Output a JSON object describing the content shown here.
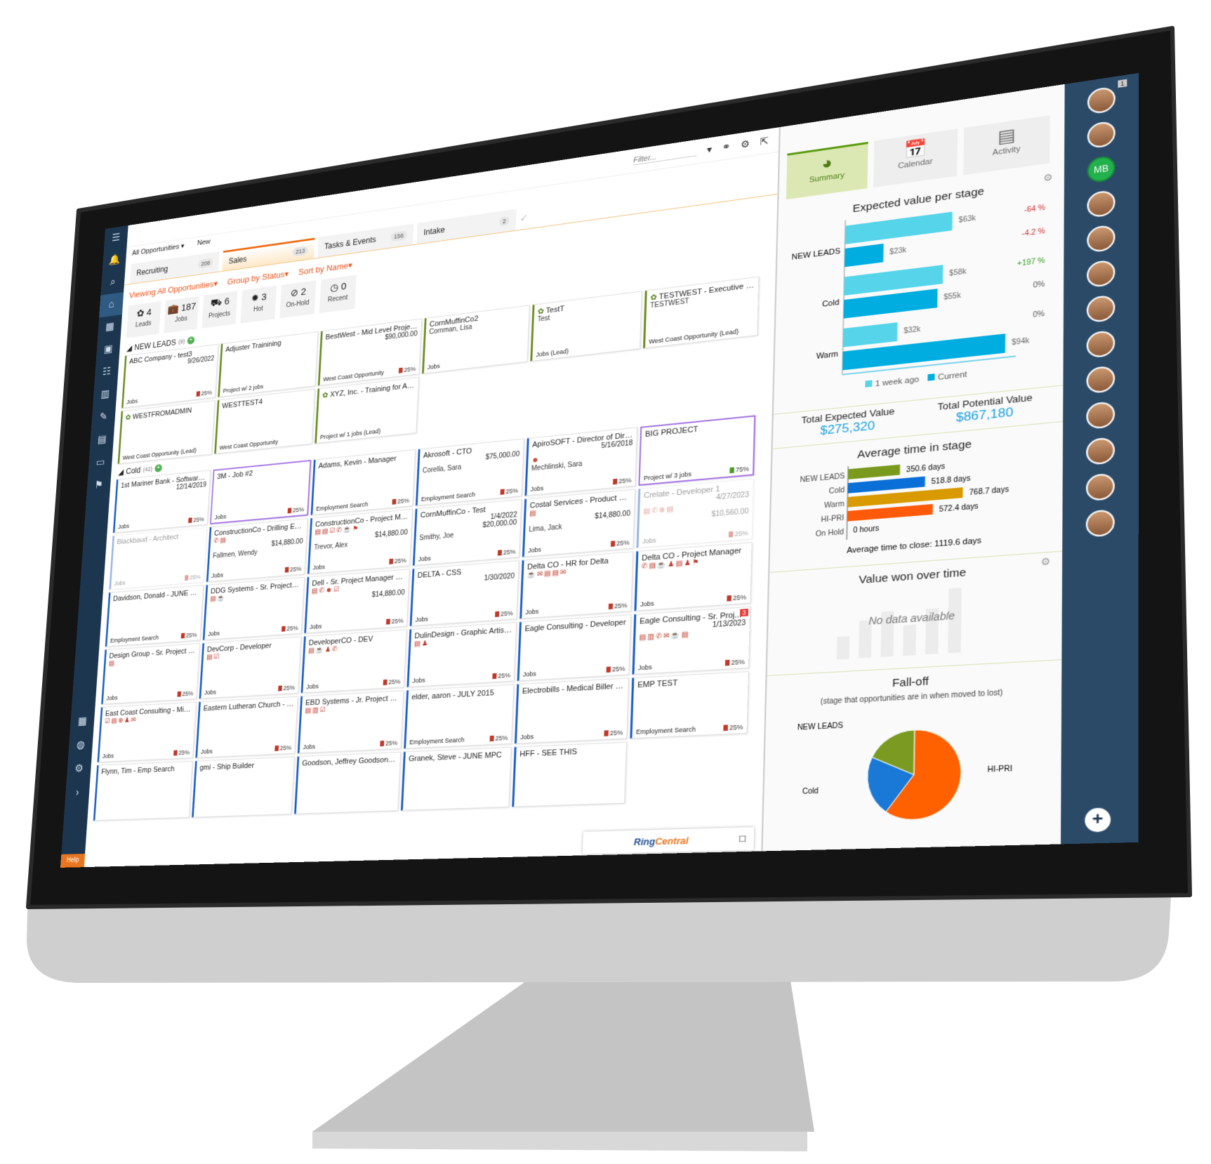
{
  "nav": {
    "icons": [
      "menu-icon",
      "bell-icon",
      "search-icon",
      "home-icon",
      "building-icon",
      "briefcase-icon",
      "people-icon",
      "chart-icon",
      "megaphone-icon",
      "document-icon",
      "folder-icon",
      "flag-icon",
      "calendar-icon",
      "globe-icon",
      "settings-icon",
      "chevron-right-icon"
    ],
    "help": "Help"
  },
  "topbar": {
    "filter_placeholder": "Filter..."
  },
  "viewtabs": {
    "all": "All Opportunities ▾",
    "new": "New"
  },
  "tabs": [
    {
      "label": "Recruiting",
      "count": "208"
    },
    {
      "label": "Sales",
      "count": "213",
      "active": true
    },
    {
      "label": "Tasks & Events",
      "count": "156"
    },
    {
      "label": "Intake",
      "count": "2"
    }
  ],
  "viewrow": {
    "viewing": "Viewing",
    "viewing_val": "All Opportunities▾",
    "group": "Group by",
    "group_val": "Status▾",
    "sort": "Sort by",
    "sort_val": "Name▾"
  },
  "stats": [
    {
      "icon": "sprout-icon",
      "glyph": "✿",
      "value": "4",
      "label": "Leads"
    },
    {
      "icon": "briefcase-icon",
      "glyph": "💼",
      "value": "187",
      "label": "Jobs"
    },
    {
      "icon": "project-icon",
      "glyph": "⛟",
      "value": "6",
      "label": "Projects"
    },
    {
      "icon": "hot-icon",
      "glyph": "✹",
      "value": "3",
      "label": "Hot"
    },
    {
      "icon": "on-hold-icon",
      "glyph": "⊘",
      "value": "2",
      "label": "On-Hold"
    },
    {
      "icon": "clock-icon",
      "glyph": "◷",
      "value": "0",
      "label": "Recent"
    }
  ],
  "groups": [
    {
      "name": "NEW LEADS",
      "count": "(9)",
      "kind": "lead",
      "cards": [
        {
          "title": "ABC Company - test3",
          "date": "9/26/2022",
          "type": "Jobs",
          "pct": "25%"
        },
        {
          "title": "Adjuster Trainining",
          "type": "Project w/ 2 jobs"
        },
        {
          "title": "BestWest - Mid Level Project ...",
          "value": "$90,000.00",
          "type": "West Coast Opportunity",
          "pct": "25%"
        },
        {
          "title": "CornMuffinCo2",
          "contact": "Cornman, Lisa",
          "type": "Jobs"
        },
        {
          "title": "TestT",
          "lead": true,
          "contact": "Test",
          "type": "Jobs (Lead)"
        },
        {
          "title": "TESTWEST - Executive Dir...",
          "lead": true,
          "contact": "TESTWEST",
          "type": "West Coast Opportunity (Lead)"
        },
        {
          "title": "WESTFROMADMIN",
          "lead": true,
          "type": "West Coast Opportunity (Lead)"
        },
        {
          "title": "WESTTEST4",
          "type": "West Coast Opportunity"
        },
        {
          "title": "XYZ, Inc. - Training for Adj...",
          "lead": true,
          "type": "Project w/ 1 jobs (Lead)"
        }
      ]
    },
    {
      "name": "Cold",
      "count": "(42)",
      "kind": "cold",
      "cards": [
        {
          "title": "1st Mariner Bank - Software ...",
          "date": "12/14/2019",
          "type": "Jobs",
          "pct": "25%"
        },
        {
          "title": "3M - Job #2",
          "type": "Jobs",
          "pct": "25%",
          "purple": true
        },
        {
          "title": "Adams, Kevin - Manager",
          "type": "Employment Search",
          "pct": "25%"
        },
        {
          "title": "Akrosoft - CTO",
          "value": "$75,000.00",
          "contact": "Corella, Sara",
          "type": "Employment Search",
          "pct": "25%"
        },
        {
          "title": "ApiroSOFT - Director of Direc...",
          "date": "5/16/2018",
          "contact": "Mechlinski, Sara",
          "type": "Jobs",
          "pct": "25%",
          "icons": "☻"
        },
        {
          "title": "BIG PROJECT",
          "type": "Project w/ 3 jobs",
          "pct": "75%",
          "purple": true,
          "green": true
        },
        {
          "title": "Blackbaud - Architect",
          "type": "Jobs",
          "pct": "25%",
          "faded": true
        },
        {
          "title": "ConstructionCo - Drilling En...",
          "value": "$14,880.00",
          "contact": "Fallmen, Wendy",
          "type": "Jobs",
          "pct": "25%",
          "icons": "✆▤"
        },
        {
          "title": "ConstructionCo - Project Ma...",
          "value": "$14,880.00",
          "contact": "Trevor, Alex",
          "type": "Jobs",
          "pct": "25%",
          "icons": "▤▤☑✆☕⚑"
        },
        {
          "title": "CornMuffinCo - Test",
          "date": "1/4/2022",
          "value": "$20,000.00",
          "contact": "Smithy, Joe",
          "type": "Jobs",
          "pct": "25%"
        },
        {
          "title": "Costal Services - Product Ma...",
          "value": "$14,880.00",
          "contact": "Lima, Jack",
          "type": "Jobs",
          "pct": "25%",
          "icons": "▤"
        },
        {
          "title": "Crelate - Developer 1",
          "date": "4/27/2023",
          "value": "$10,560.00",
          "type": "Jobs",
          "pct": "25%",
          "faded": true,
          "icons": "▤✆⊗▤"
        },
        {
          "title": "Davidson, Donald - JUNE MP...",
          "type": "Employment Search",
          "pct": "25%"
        },
        {
          "title": "DDG Systems - Sr. Project M...",
          "type": "Jobs",
          "pct": "25%",
          "icons": "▤☕"
        },
        {
          "title": "Dell - Sr. Project Manager #3...",
          "value": "$14,880.00",
          "type": "Jobs",
          "pct": "25%",
          "icons": "▤✆☻☑"
        },
        {
          "title": "DELTA - CSS",
          "date": "1/30/2020",
          "type": "Jobs",
          "pct": "25%"
        },
        {
          "title": "Delta CO - HR for Delta",
          "type": "Jobs",
          "pct": "25%",
          "icons": "☕✉▤▤✉"
        },
        {
          "title": "Delta CO - Project Manager",
          "type": "Jobs",
          "pct": "25%",
          "icons": "✆▤☕♟▤♟⚑"
        },
        {
          "title": "Design Group - Sr. Project M...",
          "type": "Jobs",
          "pct": "25%",
          "icons": "▤"
        },
        {
          "title": "DevCorp - Developer",
          "type": "Jobs",
          "pct": "25%",
          "icons": "▤☑"
        },
        {
          "title": "DeveloperCO - DEV",
          "type": "Jobs",
          "pct": "25%",
          "icons": "▤☕♟✆"
        },
        {
          "title": "DulinDesign - Graphic Artist I...",
          "type": "Jobs",
          "pct": "25%",
          "icons": "▤♟"
        },
        {
          "title": "Eagle Consulting - Developer",
          "type": "Jobs",
          "pct": "25%"
        },
        {
          "title": "Eagle Consulting - Sr. Proj...",
          "date": "1/13/2023",
          "type": "Jobs",
          "pct": "25%",
          "badge": "3",
          "icons": "▤▥✆✉☕▤"
        },
        {
          "title": "East Coast Consulting - Mid ...",
          "type": "Jobs",
          "pct": "25%",
          "icons": "☑▤⊗♟✉"
        },
        {
          "title": "Eastern Lutheran Church - M...",
          "type": "Jobs",
          "pct": "25%"
        },
        {
          "title": "EBD Systems - Jr. Project Ma...",
          "type": "Jobs",
          "pct": "25%",
          "icons": "▤▥☑"
        },
        {
          "title": "elder, aaron - JULY 2015",
          "type": "Employment Search",
          "pct": "25%"
        },
        {
          "title": "Electrobills - Medical Biller - ...",
          "type": "Jobs",
          "pct": "25%"
        },
        {
          "title": "EMP TEST",
          "type": "Employment Search",
          "pct": "25%"
        },
        {
          "title": "Flynn, Tim - Emp Search"
        },
        {
          "title": "gmi - Ship Builder"
        },
        {
          "title": "Goodson, Jeffrey Goodson - ..."
        },
        {
          "title": "Granek, Steve - JUNE MPC"
        },
        {
          "title": "HFF - SEE THIS"
        }
      ]
    }
  ],
  "ringcentral": {
    "brand": "Ring",
    "brand2": "Central"
  },
  "panel": {
    "tabs": [
      {
        "label": "Summary",
        "icon": "pie-chart-icon",
        "glyph": "◕",
        "active": true
      },
      {
        "label": "Calendar",
        "icon": "calendar-icon",
        "glyph": "📅"
      },
      {
        "label": "Activity",
        "icon": "activity-icon",
        "glyph": "▤"
      }
    ],
    "totals": {
      "expected_label": "Total Expected Value",
      "expected": "$275,320",
      "potential_label": "Total Potential Value",
      "potential": "$867,180"
    },
    "value_won": {
      "title": "Value won over time",
      "empty": "No data available"
    }
  },
  "chart_data": [
    {
      "type": "bar",
      "title": "Expected value per stage",
      "categories": [
        "NEW LEADS",
        "Cold",
        "Warm"
      ],
      "series": [
        {
          "name": "1 week ago",
          "values": [
            63,
            58,
            32
          ],
          "labels": [
            "$63k",
            "$58k",
            "$32k"
          ],
          "color": "#55d4ea"
        },
        {
          "name": "Current",
          "values": [
            23,
            55,
            94
          ],
          "labels": [
            "$23k",
            "$55k",
            "$94k"
          ],
          "color": "#00ade0"
        }
      ],
      "unit": "$k",
      "annotations": [
        "-64 %",
        "-4.2 %",
        "+197 %",
        "0%",
        "0%"
      ],
      "annotation_colors": [
        "#d32f2f",
        "#d32f2f",
        "#2e9e1e",
        "#555",
        "#555"
      ],
      "orientation": "horizontal",
      "legend": "bottom"
    },
    {
      "type": "bar",
      "title": "Average time in stage",
      "categories": [
        "NEW LEADS",
        "Cold",
        "Warm",
        "HI-PRI",
        "On Hold"
      ],
      "values": [
        350.6,
        518.8,
        768.7,
        572.4,
        0
      ],
      "labels": [
        "350.6 days",
        "518.8 days",
        "768.7 days",
        "572.4 days",
        "0 hours"
      ],
      "colors": [
        "#7a9a1e",
        "#0a6fd6",
        "#d99a00",
        "#ff5a0a",
        "#999999"
      ],
      "unit": "days",
      "orientation": "horizontal",
      "footer": "Average time to close: 1119.6 days"
    },
    {
      "type": "pie",
      "title": "Fall-off",
      "subtitle": "(stage that opportunities are in when moved to lost)",
      "slices": [
        {
          "label": "HI-PRI",
          "value": 60,
          "color": "#ff6000"
        },
        {
          "label": "Cold",
          "value": 22,
          "color": "#1a78d6"
        },
        {
          "label": "NEW LEADS",
          "value": 18,
          "color": "#7a9a22"
        }
      ]
    }
  ],
  "strip": {
    "avatars": [
      "avatar",
      "avatar",
      "MB",
      "avatar",
      "avatar",
      "avatar",
      "avatar",
      "avatar",
      "avatar",
      "avatar",
      "avatar",
      "avatar",
      "avatar"
    ],
    "notification": "1"
  }
}
